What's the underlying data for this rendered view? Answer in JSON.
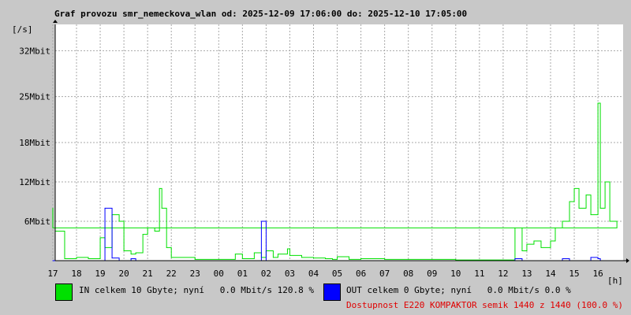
{
  "chart_data": {
    "type": "line",
    "title": "Graf provozu smr_nemeckova_wlan od: 2025-12-09 17:06:00 do: 2025-12-10 17:05:00",
    "ylabel": "[/s]",
    "xlabel": "[h]",
    "x_hours": [
      17.1,
      17.5,
      18.0,
      18.5,
      19.0,
      19.2,
      19.5,
      19.8,
      20.0,
      20.3,
      20.5,
      20.8,
      21.0,
      21.3,
      21.5,
      21.6,
      21.8,
      22.0,
      23.0,
      0.0,
      0.7,
      1.0,
      1.5,
      1.8,
      2.0,
      2.3,
      2.5,
      2.9,
      3.0,
      3.5,
      4.0,
      4.5,
      4.8,
      5.0,
      5.5,
      6.0,
      7.0,
      8.0,
      9.0,
      10.0,
      11.0,
      12.0,
      12.5,
      12.8,
      13.0,
      13.3,
      13.6,
      14.0,
      14.2,
      14.5,
      14.8,
      15.0,
      15.2,
      15.5,
      15.7,
      16.0,
      16.1,
      16.3,
      16.5,
      16.8,
      17.0
    ],
    "series": [
      {
        "name": "IN",
        "color": "#00e000",
        "values": [
          4.5,
          0.3,
          0.5,
          0.3,
          3.5,
          2.0,
          7.0,
          6.0,
          1.5,
          1.0,
          1.2,
          4.0,
          5.0,
          4.5,
          11.0,
          8.0,
          2.0,
          0.5,
          0.2,
          0.2,
          1.0,
          0.3,
          1.2,
          0.5,
          1.5,
          0.5,
          1.0,
          1.8,
          0.8,
          0.5,
          0.4,
          0.3,
          0.2,
          0.6,
          0.2,
          0.3,
          0.2,
          0.2,
          0.2,
          0.1,
          0.1,
          0.1,
          5.0,
          1.5,
          2.5,
          3.0,
          2.0,
          3.0,
          5.0,
          6.0,
          9.0,
          11.0,
          8.0,
          10.0,
          7.0,
          24.0,
          8.0,
          12.0,
          6.0,
          5.0,
          8.0
        ]
      },
      {
        "name": "OUT",
        "color": "#0000ff",
        "values": [
          0,
          0,
          0,
          0,
          0,
          8.0,
          0.4,
          0,
          0,
          0.3,
          0,
          0,
          0,
          0,
          0,
          0,
          0,
          0,
          0,
          0,
          0,
          0,
          0,
          6.0,
          0,
          0,
          0,
          0,
          0,
          0,
          0,
          0,
          0,
          0,
          0,
          0,
          0,
          0,
          0,
          0,
          0,
          0,
          0.3,
          0,
          0,
          0,
          0,
          0,
          0,
          0.3,
          0,
          0,
          0,
          0,
          0.5,
          0.3,
          0,
          0,
          0,
          0,
          0
        ]
      }
    ],
    "ylim": [
      0,
      36
    ],
    "yticks": [
      {
        "v": 6,
        "label": "6Mbit"
      },
      {
        "v": 12,
        "label": "12Mbit"
      },
      {
        "v": 18,
        "label": "18Mbit"
      },
      {
        "v": 25,
        "label": "25Mbit"
      },
      {
        "v": 32,
        "label": "32Mbit"
      }
    ],
    "xticks": [
      {
        "h": 18,
        "label": "18"
      },
      {
        "h": 19,
        "label": "19"
      },
      {
        "h": 20,
        "label": "20"
      },
      {
        "h": 21,
        "label": "21"
      },
      {
        "h": 22,
        "label": "22"
      },
      {
        "h": 23,
        "label": "23"
      },
      {
        "h": 0,
        "label": "00"
      },
      {
        "h": 1,
        "label": "01"
      },
      {
        "h": 2,
        "label": "02"
      },
      {
        "h": 3,
        "label": "03"
      },
      {
        "h": 4,
        "label": "04"
      },
      {
        "h": 5,
        "label": "05"
      },
      {
        "h": 6,
        "label": "06"
      },
      {
        "h": 7,
        "label": "07"
      },
      {
        "h": 8,
        "label": "08"
      },
      {
        "h": 9,
        "label": "09"
      },
      {
        "h": 10,
        "label": "10"
      },
      {
        "h": 11,
        "label": "11"
      },
      {
        "h": 12,
        "label": "12"
      },
      {
        "h": 13,
        "label": "13"
      },
      {
        "h": 14,
        "label": "14"
      },
      {
        "h": 15,
        "label": "15"
      },
      {
        "h": 16,
        "label": "16"
      },
      {
        "h": 17,
        "label": "17"
      }
    ],
    "grid": true
  },
  "legend": {
    "in_text": "IN celkem 10 Gbyte; nyní   0.0 Mbit/s 120.8 %",
    "out_text": "OUT celkem 0 Gbyte; nyní   0.0 Mbit/s 0.0 %",
    "availability_text": "Dostupnost E220 KOMPAKTOR semik 1440 z 1440 (100.0 %)",
    "in_color": "#00e000",
    "out_color": "#0000ff",
    "availability_color": "#e00000"
  }
}
